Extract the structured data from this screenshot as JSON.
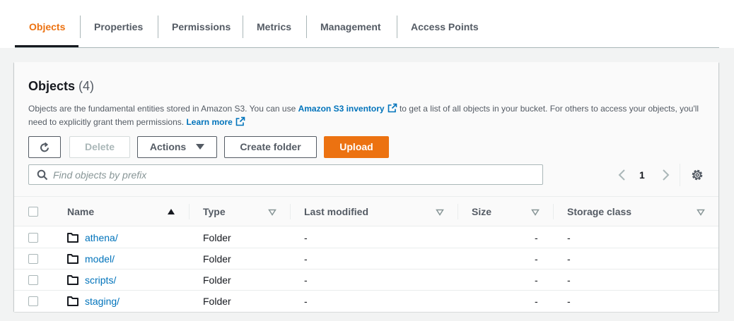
{
  "tabs": [
    {
      "label": "Objects",
      "active": true
    },
    {
      "label": "Properties"
    },
    {
      "label": "Permissions"
    },
    {
      "label": "Metrics"
    },
    {
      "label": "Management"
    },
    {
      "label": "Access Points"
    }
  ],
  "objects_panel": {
    "title": "Objects",
    "count": "(4)",
    "description": {
      "part1": "Objects are the fundamental entities stored in Amazon S3. You can use ",
      "link1": "Amazon S3 inventory",
      "part2": " to get a list of all objects in your bucket. For others to access your objects, you'll need to explicitly grant them permissions. ",
      "link2": "Learn more"
    },
    "toolbar": {
      "refresh_icon": "refresh-icon",
      "delete_label": "Delete",
      "actions_label": "Actions",
      "create_folder_label": "Create folder",
      "upload_label": "Upload"
    },
    "search": {
      "placeholder": "Find objects by prefix",
      "value": ""
    },
    "pagination": {
      "current_page": "1"
    }
  },
  "table": {
    "columns": [
      "Name",
      "Type",
      "Last modified",
      "Size",
      "Storage class"
    ],
    "rows": [
      {
        "name": "athena/",
        "type": "Folder",
        "last_modified": "-",
        "size": "-",
        "storage_class": "-"
      },
      {
        "name": "model/",
        "type": "Folder",
        "last_modified": "-",
        "size": "-",
        "storage_class": "-"
      },
      {
        "name": "scripts/",
        "type": "Folder",
        "last_modified": "-",
        "size": "-",
        "storage_class": "-"
      },
      {
        "name": "staging/",
        "type": "Folder",
        "last_modified": "-",
        "size": "-",
        "storage_class": "-"
      }
    ]
  },
  "colors": {
    "accent": "#ec7211",
    "link": "#0073bb",
    "text": "#16191f",
    "muted": "#545b64"
  }
}
